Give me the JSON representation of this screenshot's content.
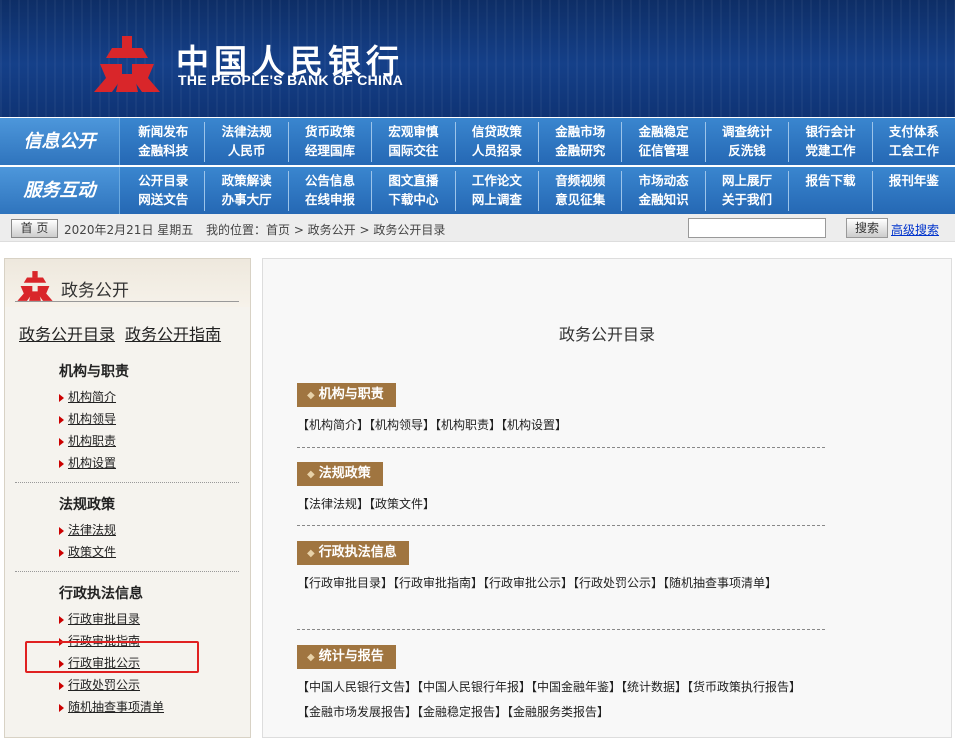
{
  "header": {
    "title_cn": "中国人民银行",
    "title_en": "THE PEOPLE'S BANK OF CHINA",
    "logo_icon": "pboc-emblem-icon",
    "colors": {
      "banner": "#154089",
      "emblem": "#d9262a",
      "nav": "#2e74c0"
    }
  },
  "nav1": {
    "title": "信息公开",
    "cols": [
      [
        "新闻发布",
        "金融科技"
      ],
      [
        "法律法规",
        "人民币"
      ],
      [
        "货币政策",
        "经理国库"
      ],
      [
        "宏观审慎",
        "国际交往"
      ],
      [
        "信贷政策",
        "人员招录"
      ],
      [
        "金融市场",
        "金融研究"
      ],
      [
        "金融稳定",
        "征信管理"
      ],
      [
        "调查统计",
        "反洗钱"
      ],
      [
        "银行会计",
        "党建工作"
      ],
      [
        "支付体系",
        "工会工作"
      ]
    ]
  },
  "nav2": {
    "title": "服务互动",
    "cols": [
      [
        "公开目录",
        "网送文告"
      ],
      [
        "政策解读",
        "办事大厅"
      ],
      [
        "公告信息",
        "在线申报"
      ],
      [
        "图文直播",
        "下载中心"
      ],
      [
        "工作论文",
        "网上调查"
      ],
      [
        "音频视频",
        "意见征集"
      ],
      [
        "市场动态",
        "金融知识"
      ],
      [
        "网上展厅",
        "关于我们"
      ],
      [
        "报告下载",
        ""
      ],
      [
        "报刊年鉴",
        ""
      ]
    ]
  },
  "infobar": {
    "home": "首 页",
    "date": "2020年2月21日 星期五",
    "location": "我的位置：首页 > 政务公开 > 政务公开目录",
    "search_button": "搜索",
    "advanced_search": "高级搜索",
    "search_value": ""
  },
  "sidebar": {
    "title": "政务公开",
    "top_links": [
      "政务公开目录",
      "政务公开指南"
    ],
    "groups": [
      {
        "title": "机构与职责",
        "items": [
          "机构简介",
          "机构领导",
          "机构职责",
          "机构设置"
        ]
      },
      {
        "title": "法规政策",
        "items": [
          "法律法规",
          "政策文件"
        ]
      },
      {
        "title": "行政执法信息",
        "items": [
          "行政审批目录",
          "行政审批指南",
          "行政审批公示",
          "行政处罚公示",
          "随机抽查事项清单"
        ]
      }
    ],
    "highlight_color": "#e02020"
  },
  "main": {
    "title": "政务公开目录",
    "sections": [
      {
        "head": "机构与职责",
        "links": "【机构简介】【机构领导】【机构职责】【机构设置】"
      },
      {
        "head": "法规政策",
        "links": "【法律法规】【政策文件】"
      },
      {
        "head": "行政执法信息",
        "links": "【行政审批目录】【行政审批指南】【行政审批公示】【行政处罚公示】【随机抽查事项清单】"
      },
      {
        "head": "统计与报告",
        "links": "【中国人民银行文告】【中国人民银行年报】【中国金融年鉴】【统计数据】【货币政策执行报告】【金融市场发展报告】【金融稳定报告】【金融服务类报告】"
      }
    ]
  }
}
